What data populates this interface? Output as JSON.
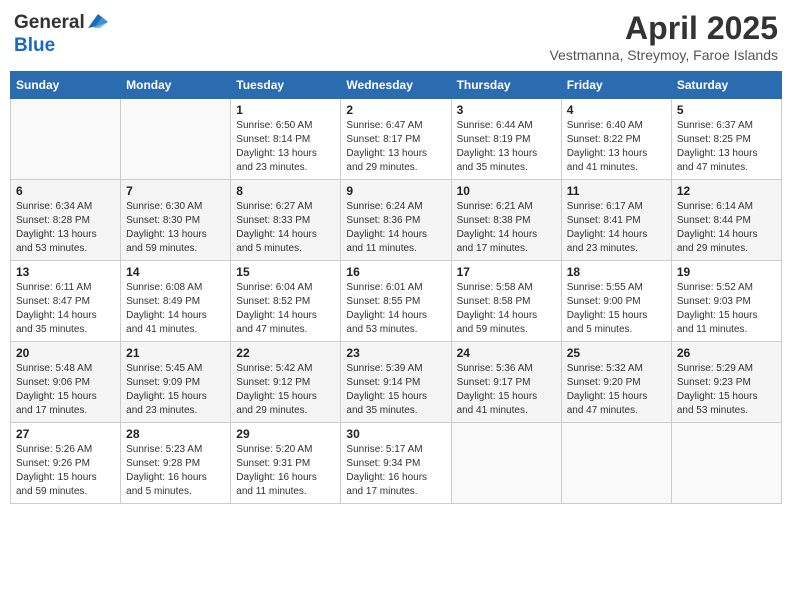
{
  "header": {
    "logo_general": "General",
    "logo_blue": "Blue",
    "month_title": "April 2025",
    "subtitle": "Vestmanna, Streymoy, Faroe Islands"
  },
  "weekdays": [
    "Sunday",
    "Monday",
    "Tuesday",
    "Wednesday",
    "Thursday",
    "Friday",
    "Saturday"
  ],
  "weeks": [
    [
      {
        "day": "",
        "info": ""
      },
      {
        "day": "",
        "info": ""
      },
      {
        "day": "1",
        "sunrise": "Sunrise: 6:50 AM",
        "sunset": "Sunset: 8:14 PM",
        "daylight": "Daylight: 13 hours and 23 minutes."
      },
      {
        "day": "2",
        "sunrise": "Sunrise: 6:47 AM",
        "sunset": "Sunset: 8:17 PM",
        "daylight": "Daylight: 13 hours and 29 minutes."
      },
      {
        "day": "3",
        "sunrise": "Sunrise: 6:44 AM",
        "sunset": "Sunset: 8:19 PM",
        "daylight": "Daylight: 13 hours and 35 minutes."
      },
      {
        "day": "4",
        "sunrise": "Sunrise: 6:40 AM",
        "sunset": "Sunset: 8:22 PM",
        "daylight": "Daylight: 13 hours and 41 minutes."
      },
      {
        "day": "5",
        "sunrise": "Sunrise: 6:37 AM",
        "sunset": "Sunset: 8:25 PM",
        "daylight": "Daylight: 13 hours and 47 minutes."
      }
    ],
    [
      {
        "day": "6",
        "sunrise": "Sunrise: 6:34 AM",
        "sunset": "Sunset: 8:28 PM",
        "daylight": "Daylight: 13 hours and 53 minutes."
      },
      {
        "day": "7",
        "sunrise": "Sunrise: 6:30 AM",
        "sunset": "Sunset: 8:30 PM",
        "daylight": "Daylight: 13 hours and 59 minutes."
      },
      {
        "day": "8",
        "sunrise": "Sunrise: 6:27 AM",
        "sunset": "Sunset: 8:33 PM",
        "daylight": "Daylight: 14 hours and 5 minutes."
      },
      {
        "day": "9",
        "sunrise": "Sunrise: 6:24 AM",
        "sunset": "Sunset: 8:36 PM",
        "daylight": "Daylight: 14 hours and 11 minutes."
      },
      {
        "day": "10",
        "sunrise": "Sunrise: 6:21 AM",
        "sunset": "Sunset: 8:38 PM",
        "daylight": "Daylight: 14 hours and 17 minutes."
      },
      {
        "day": "11",
        "sunrise": "Sunrise: 6:17 AM",
        "sunset": "Sunset: 8:41 PM",
        "daylight": "Daylight: 14 hours and 23 minutes."
      },
      {
        "day": "12",
        "sunrise": "Sunrise: 6:14 AM",
        "sunset": "Sunset: 8:44 PM",
        "daylight": "Daylight: 14 hours and 29 minutes."
      }
    ],
    [
      {
        "day": "13",
        "sunrise": "Sunrise: 6:11 AM",
        "sunset": "Sunset: 8:47 PM",
        "daylight": "Daylight: 14 hours and 35 minutes."
      },
      {
        "day": "14",
        "sunrise": "Sunrise: 6:08 AM",
        "sunset": "Sunset: 8:49 PM",
        "daylight": "Daylight: 14 hours and 41 minutes."
      },
      {
        "day": "15",
        "sunrise": "Sunrise: 6:04 AM",
        "sunset": "Sunset: 8:52 PM",
        "daylight": "Daylight: 14 hours and 47 minutes."
      },
      {
        "day": "16",
        "sunrise": "Sunrise: 6:01 AM",
        "sunset": "Sunset: 8:55 PM",
        "daylight": "Daylight: 14 hours and 53 minutes."
      },
      {
        "day": "17",
        "sunrise": "Sunrise: 5:58 AM",
        "sunset": "Sunset: 8:58 PM",
        "daylight": "Daylight: 14 hours and 59 minutes."
      },
      {
        "day": "18",
        "sunrise": "Sunrise: 5:55 AM",
        "sunset": "Sunset: 9:00 PM",
        "daylight": "Daylight: 15 hours and 5 minutes."
      },
      {
        "day": "19",
        "sunrise": "Sunrise: 5:52 AM",
        "sunset": "Sunset: 9:03 PM",
        "daylight": "Daylight: 15 hours and 11 minutes."
      }
    ],
    [
      {
        "day": "20",
        "sunrise": "Sunrise: 5:48 AM",
        "sunset": "Sunset: 9:06 PM",
        "daylight": "Daylight: 15 hours and 17 minutes."
      },
      {
        "day": "21",
        "sunrise": "Sunrise: 5:45 AM",
        "sunset": "Sunset: 9:09 PM",
        "daylight": "Daylight: 15 hours and 23 minutes."
      },
      {
        "day": "22",
        "sunrise": "Sunrise: 5:42 AM",
        "sunset": "Sunset: 9:12 PM",
        "daylight": "Daylight: 15 hours and 29 minutes."
      },
      {
        "day": "23",
        "sunrise": "Sunrise: 5:39 AM",
        "sunset": "Sunset: 9:14 PM",
        "daylight": "Daylight: 15 hours and 35 minutes."
      },
      {
        "day": "24",
        "sunrise": "Sunrise: 5:36 AM",
        "sunset": "Sunset: 9:17 PM",
        "daylight": "Daylight: 15 hours and 41 minutes."
      },
      {
        "day": "25",
        "sunrise": "Sunrise: 5:32 AM",
        "sunset": "Sunset: 9:20 PM",
        "daylight": "Daylight: 15 hours and 47 minutes."
      },
      {
        "day": "26",
        "sunrise": "Sunrise: 5:29 AM",
        "sunset": "Sunset: 9:23 PM",
        "daylight": "Daylight: 15 hours and 53 minutes."
      }
    ],
    [
      {
        "day": "27",
        "sunrise": "Sunrise: 5:26 AM",
        "sunset": "Sunset: 9:26 PM",
        "daylight": "Daylight: 15 hours and 59 minutes."
      },
      {
        "day": "28",
        "sunrise": "Sunrise: 5:23 AM",
        "sunset": "Sunset: 9:28 PM",
        "daylight": "Daylight: 16 hours and 5 minutes."
      },
      {
        "day": "29",
        "sunrise": "Sunrise: 5:20 AM",
        "sunset": "Sunset: 9:31 PM",
        "daylight": "Daylight: 16 hours and 11 minutes."
      },
      {
        "day": "30",
        "sunrise": "Sunrise: 5:17 AM",
        "sunset": "Sunset: 9:34 PM",
        "daylight": "Daylight: 16 hours and 17 minutes."
      },
      {
        "day": "",
        "info": ""
      },
      {
        "day": "",
        "info": ""
      },
      {
        "day": "",
        "info": ""
      }
    ]
  ]
}
